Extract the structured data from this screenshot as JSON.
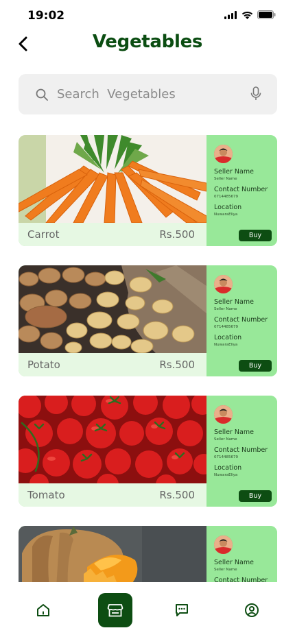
{
  "status_bar": {
    "time": "19:02"
  },
  "header": {
    "title": "Vegetables"
  },
  "search": {
    "placeholder": "Search  Vegetables"
  },
  "colors": {
    "brand_dark": "#0d4d12",
    "card_green": "#98e899",
    "name_bar": "#e6f8e3"
  },
  "products": [
    {
      "name": "Carrot",
      "price": "Rs.500",
      "image": "carrot",
      "seller": {
        "seller_label": "Seller Name",
        "seller_value": "Seller Name",
        "contact_label": "Contact Number",
        "contact_value": "0714485679",
        "location_label": "Location",
        "location_value": "NuwaraEliya",
        "buy_label": "Buy"
      }
    },
    {
      "name": "Potato",
      "price": "Rs.500",
      "image": "potato",
      "seller": {
        "seller_label": "Seller Name",
        "seller_value": "Seller Name",
        "contact_label": "Contact Number",
        "contact_value": "0714485679",
        "location_label": "Location",
        "location_value": "NuwaraEliya",
        "buy_label": "Buy"
      }
    },
    {
      "name": "Tomato",
      "price": "Rs.500",
      "image": "tomato",
      "seller": {
        "seller_label": "Seller Name",
        "seller_value": "Seller Name",
        "contact_label": "Contact Number",
        "contact_value": "0714485679",
        "location_label": "Location",
        "location_value": "NuwaraEliya",
        "buy_label": "Buy"
      }
    },
    {
      "name": "",
      "price": "",
      "image": "pumpkin",
      "seller": {
        "seller_label": "Seller Name",
        "seller_value": "Seller Name",
        "contact_label": "Contact Number",
        "contact_value": "",
        "location_label": "",
        "location_value": "",
        "buy_label": ""
      }
    }
  ],
  "bottom_nav": {
    "items": [
      {
        "icon": "home-icon",
        "active": false
      },
      {
        "icon": "store-icon",
        "active": true
      },
      {
        "icon": "chat-icon",
        "active": false
      },
      {
        "icon": "profile-icon",
        "active": false
      }
    ]
  }
}
